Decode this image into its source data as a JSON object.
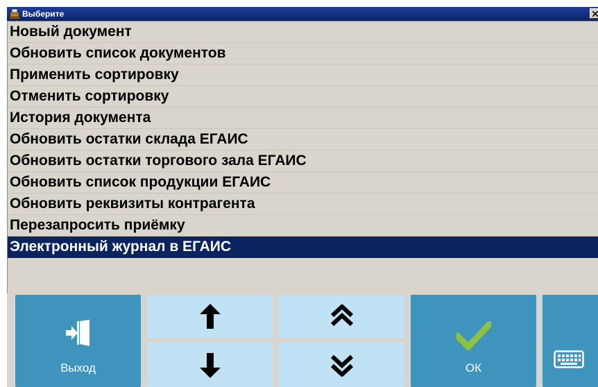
{
  "window": {
    "title": "Выберите"
  },
  "menu": {
    "items": [
      {
        "label": "Новый документ",
        "selected": false
      },
      {
        "label": "Обновить список документов",
        "selected": false
      },
      {
        "label": "Применить сортировку",
        "selected": false
      },
      {
        "label": "Отменить сортировку",
        "selected": false
      },
      {
        "label": "История документа",
        "selected": false
      },
      {
        "label": "Обновить остатки склада ЕГАИС",
        "selected": false
      },
      {
        "label": "Обновить остатки торгового зала ЕГАИС",
        "selected": false
      },
      {
        "label": "Обновить список продукции ЕГАИС",
        "selected": false
      },
      {
        "label": "Обновить реквизиты контрагента",
        "selected": false
      },
      {
        "label": "Перезапросить приёмку",
        "selected": false
      },
      {
        "label": "Электронный журнал в ЕГАИС",
        "selected": true
      }
    ]
  },
  "toolbar": {
    "exit_label": "Выход",
    "ok_label": "ОК",
    "icons": {
      "exit": "exit-door-icon",
      "up": "arrow-up-icon",
      "down": "arrow-down-icon",
      "page_up": "double-chevron-up-icon",
      "page_down": "double-chevron-down-icon",
      "ok": "checkmark-icon",
      "keyboard": "keyboard-icon"
    }
  },
  "colors": {
    "title_bar": "#0a246a",
    "selection": "#0b2460",
    "button_dark": "#3f94bd",
    "button_light": "#c1e2f4",
    "checkmark": "#8ec23f"
  }
}
